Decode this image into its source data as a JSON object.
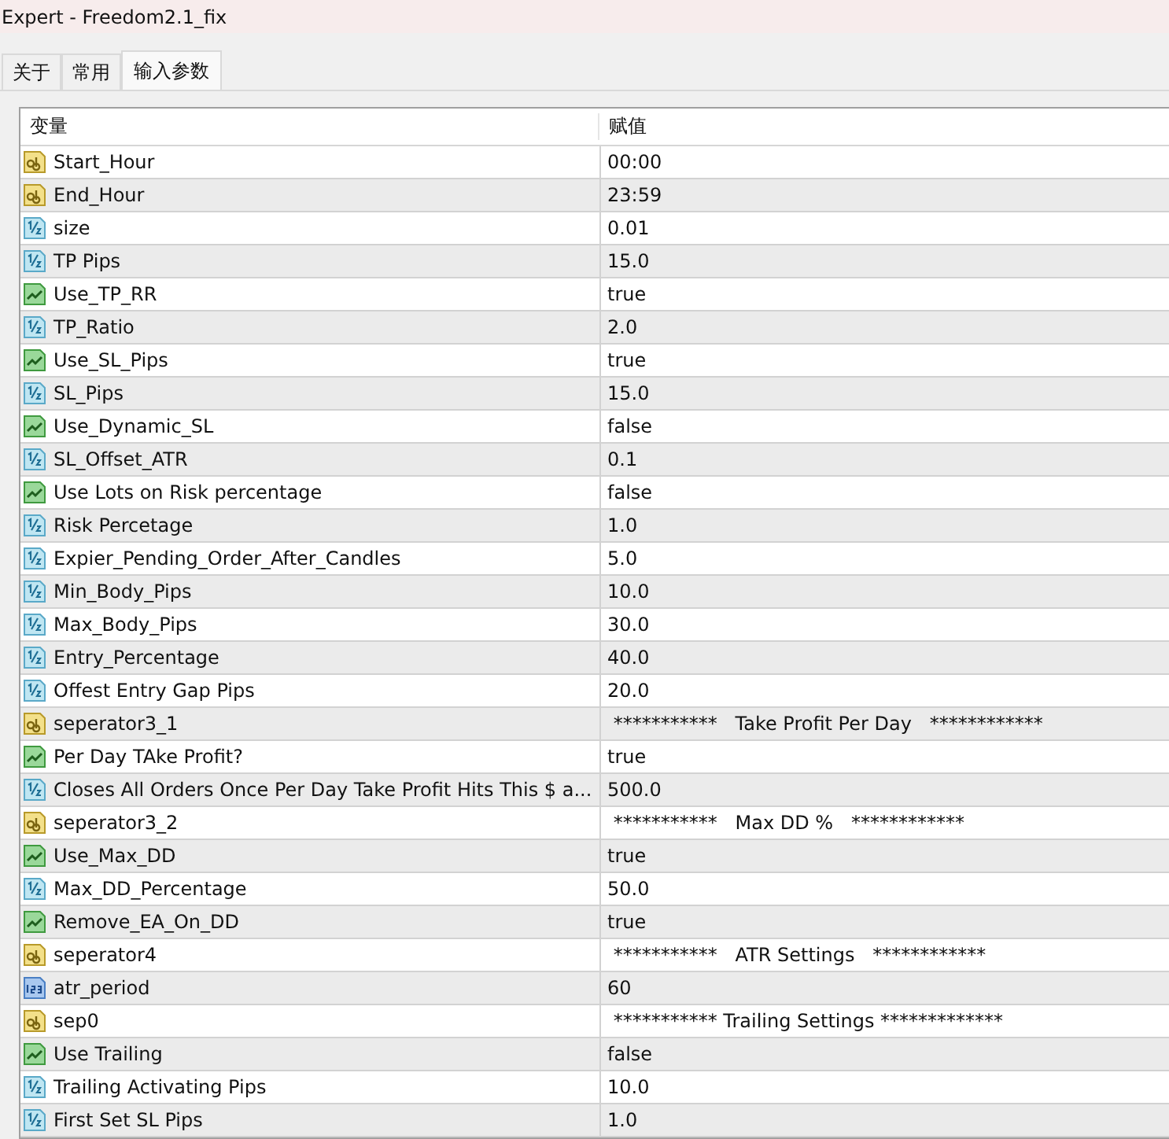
{
  "window": {
    "title": "Expert - Freedom2.1_fix"
  },
  "tabs": [
    {
      "label": "关于",
      "selected": false
    },
    {
      "label": "常用",
      "selected": false
    },
    {
      "label": "输入参数",
      "selected": true
    }
  ],
  "table": {
    "columns": [
      "变量",
      "赋值"
    ],
    "rows": [
      {
        "kind": "string",
        "name": "Start_Hour",
        "value": "00:00"
      },
      {
        "kind": "string",
        "name": "End_Hour",
        "value": "23:59"
      },
      {
        "kind": "double",
        "name": "size",
        "value": "0.01"
      },
      {
        "kind": "double",
        "name": "TP Pips",
        "value": "15.0"
      },
      {
        "kind": "bool",
        "name": "Use_TP_RR",
        "value": "true"
      },
      {
        "kind": "double",
        "name": "TP_Ratio",
        "value": "2.0"
      },
      {
        "kind": "bool",
        "name": "Use_SL_Pips",
        "value": "true"
      },
      {
        "kind": "double",
        "name": "SL_Pips",
        "value": "15.0"
      },
      {
        "kind": "bool",
        "name": "Use_Dynamic_SL",
        "value": "false"
      },
      {
        "kind": "double",
        "name": "SL_Offset_ATR",
        "value": "0.1"
      },
      {
        "kind": "bool",
        "name": "Use Lots on Risk percentage",
        "value": "false"
      },
      {
        "kind": "double",
        "name": "Risk Percetage",
        "value": "1.0"
      },
      {
        "kind": "double",
        "name": "Expier_Pending_Order_After_Candles",
        "value": "5.0"
      },
      {
        "kind": "double",
        "name": "Min_Body_Pips",
        "value": "10.0"
      },
      {
        "kind": "double",
        "name": "Max_Body_Pips",
        "value": "30.0"
      },
      {
        "kind": "double",
        "name": "Entry_Percentage",
        "value": "40.0"
      },
      {
        "kind": "double",
        "name": "Offest Entry Gap Pips",
        "value": "20.0"
      },
      {
        "kind": "string",
        "name": "seperator3_1",
        "value": " ***********   Take Profit Per Day   ************"
      },
      {
        "kind": "bool",
        "name": "Per Day TAke Profit?",
        "value": "true"
      },
      {
        "kind": "double",
        "name": "Closes All Orders Once Per Day Take Profit Hits This $ a...",
        "value": "500.0"
      },
      {
        "kind": "string",
        "name": "seperator3_2",
        "value": " ***********   Max DD %   ************"
      },
      {
        "kind": "bool",
        "name": "Use_Max_DD",
        "value": "true"
      },
      {
        "kind": "double",
        "name": "Max_DD_Percentage",
        "value": "50.0"
      },
      {
        "kind": "bool",
        "name": "Remove_EA_On_DD",
        "value": "true"
      },
      {
        "kind": "string",
        "name": "seperator4",
        "value": " ***********   ATR Settings   ************"
      },
      {
        "kind": "int",
        "name": "atr_period",
        "value": "60"
      },
      {
        "kind": "string",
        "name": "sep0",
        "value": " *********** Trailing Settings *************"
      },
      {
        "kind": "bool",
        "name": "Use Trailing",
        "value": "false"
      },
      {
        "kind": "double",
        "name": "Trailing Activating Pips",
        "value": "10.0"
      },
      {
        "kind": "double",
        "name": "First Set SL  Pips",
        "value": "1.0"
      }
    ]
  }
}
